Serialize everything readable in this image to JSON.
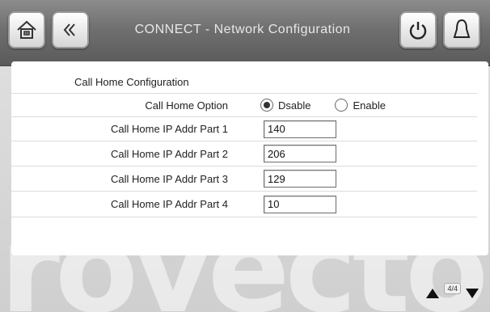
{
  "header": {
    "title": "CONNECT  - Network Configuration",
    "home_icon": "home-icon",
    "back_icon": "back-chevrons-icon",
    "power_icon": "power-icon",
    "alarm_icon": "bell-icon"
  },
  "form": {
    "section_title": "Call Home Configuration",
    "option_label": "Call Home Option",
    "options": [
      {
        "label": "Dsable",
        "selected": true
      },
      {
        "label": "Enable",
        "selected": false
      }
    ],
    "fields": [
      {
        "label": "Call Home IP Addr Part 1",
        "value": "140"
      },
      {
        "label": "Call Home IP Addr Part 2",
        "value": "206"
      },
      {
        "label": "Call Home IP Addr Part 3",
        "value": "129"
      },
      {
        "label": "Call Home IP Addr Part 4",
        "value": "10"
      }
    ]
  },
  "footer": {
    "page_indicator": "4/4"
  },
  "watermark": "rovector"
}
